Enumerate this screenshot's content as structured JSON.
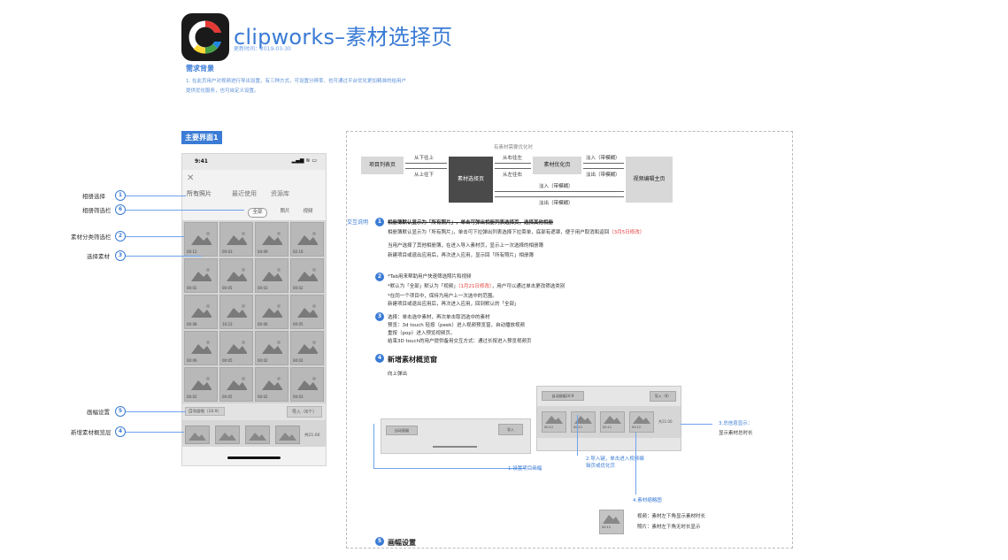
{
  "header": {
    "title": "clipworks–素材选择页",
    "updated": "更新时间：2019-03-30",
    "req_title": "需求背景",
    "req_text_1": "1. 在此页用户对视频进行导出设置，有三种方式，可设置分辨率、也可通过平台优化更加精准的给用户",
    "req_text_2": "提供优化服务，也可自定义设置。"
  },
  "section_label": "主要界面1",
  "phone": {
    "time": "9:41",
    "status_icons": "▂▄▆ ≋ ▭",
    "close": "✕",
    "tabs": [
      "所有照片",
      "最近使用",
      "资源库"
    ],
    "filters": [
      "全部",
      "照片",
      "视频"
    ],
    "durations": [
      "00:12",
      "00:03",
      "04:09",
      "02:16",
      "00:02",
      "00:05",
      "00:03",
      "00:02",
      "00:08",
      "10:23",
      "00:06",
      "00:05",
      "00:06",
      "00:05",
      "00:02",
      "00:02",
      "00:02",
      "00:05",
      "00:02",
      "00:03"
    ],
    "order_btn": "自动画幅（16:9）",
    "import_btn": "导入（6个）",
    "total": "共21:00"
  },
  "callouts": [
    {
      "n": "1",
      "label": "相册选择"
    },
    {
      "n": "6",
      "label": "相册筛选栏"
    },
    {
      "n": "2",
      "label": "素材分类筛选栏"
    },
    {
      "n": "3",
      "label": "选择素材"
    },
    {
      "n": "5",
      "label": "画幅设置"
    },
    {
      "n": "4",
      "label": "新增素材概览层"
    }
  ],
  "flow": {
    "top_note": "有素材需要优化时",
    "box_project": "项目列表页",
    "box_select": "素材选择页",
    "box_optimize": "素材优化页",
    "box_editor": "视频编辑主页",
    "lbl_down_up": "从下往上",
    "lbl_up_down": "从上往下",
    "lbl_r2l": "从右往左",
    "lbl_l2r": "从左往右",
    "lbl_fade_in": "淡入（带模糊）",
    "lbl_fade_out": "淡出（带模糊）"
  },
  "interaction_label": "交互说明",
  "notes": {
    "n1_a": "相册簿默认显示为「所有照片」，单击可弹出相册列表选择页，选择其他相册",
    "n1_b": "相册簿默认显示为「所有照片」，单击可下拉弹出列表选择下拉菜单，底部有遮罩，便于用户取消和返回",
    "n1_b_red": "（3月5日修改）",
    "n1_c": "当用户选择了其他相册簿，在进入导入素材页，显示上一次选择的相册簿",
    "n1_d": "新建项目或退出应用后，再次进入应用，显示回「所有照片」相册簿",
    "n2_a": "*Tab用来帮助用户快速筛选照片和视频",
    "n2_b": "*默认为「全部」默认为「视频」",
    "n2_b_red": "（1月21日修改）",
    "n2_b_tail": "，用户可以通过单击更改筛选类别",
    "n2_c": "*在同一个项目中，保持为用户上一次选中的范围。",
    "n2_d": "新建项目或退出应用后，再次进入应用，回到默认的「全部」",
    "n3_a": "选择：单击选中素材，再次单击取消选中的素材",
    "n3_b": "预览：3d touch 轻按（peek）进入视频预览窗，自动播放视频",
    "n3_c": "重按（pop）进入预览视频页。",
    "n3_d": "结束3D touch的用户提供备用交互方式：通过长按进入预览视频页",
    "n4_title": "新增素材概览窗",
    "n4_sub": "向上弹出",
    "n5_title": "画幅设置"
  },
  "mock": {
    "auto_btn": "自动画幅",
    "import_btn": "导入",
    "auto_btn2": "自动画幅16:9",
    "import_btn2": "导入（6）",
    "total": "共21:00",
    "dur": [
      "00:12",
      "00:12",
      "00:12",
      "00:12"
    ]
  },
  "annotations": {
    "a1": "1.设置项目画幅",
    "a2a": "2.导入键，单击进入视频编",
    "a2b": "辑页或优化页",
    "a3a": "3.总信息显示：",
    "a3b": "显示素材总时长",
    "a4": "4.素材缩略图",
    "legend_video": "视频：素材左下角显示素材时长",
    "legend_photo": "照片：素材左下角无时长显示",
    "legend_dur": "00:12"
  }
}
